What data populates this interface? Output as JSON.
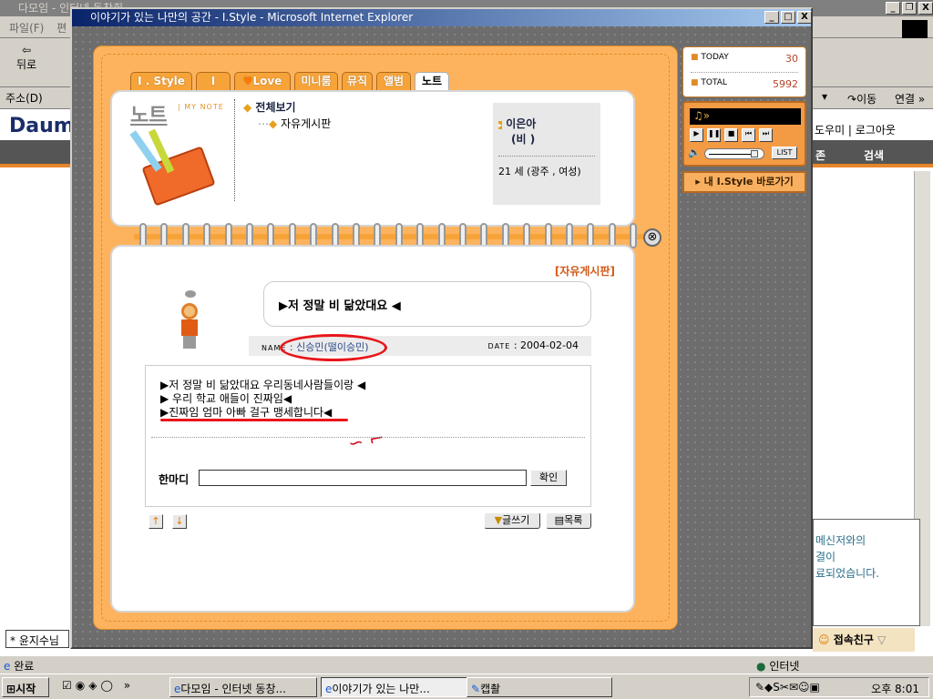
{
  "background_window": {
    "title": "다모임 - 인터넷 동창회",
    "menu_file": "파일(F)",
    "menu_edit": "편",
    "back_label": "뒤로",
    "address_label": "주소(D)",
    "go_label": "이동",
    "links_label": "연결 »",
    "logo": "Daum",
    "help_logout": "도우미 | 로그아웃",
    "nav_zone": "존",
    "nav_search": "검색",
    "messenger_lines": [
      "메신저와의",
      "결이",
      "료되었습니다."
    ],
    "friends_label": "접속친구",
    "chat_input": "* 윤지수님",
    "status_text": "완료",
    "zone_text": "인터넷"
  },
  "popup": {
    "title": "이야기가 있는 나만의 공간 - I.Style - Microsoft Internet Explorer",
    "tabs": [
      {
        "label": "I . Style"
      },
      {
        "label": "I"
      },
      {
        "label": "Love"
      },
      {
        "label": "미니룸"
      },
      {
        "label": "뮤직"
      },
      {
        "label": "앨범"
      },
      {
        "label": "노트",
        "active": true
      }
    ],
    "note_title": "노트",
    "note_subtitle": "| MY NOTE",
    "tree": {
      "root": "전체보기",
      "child": "자유게시판"
    },
    "profile": {
      "name": "이은아",
      "nickname": "(비 )",
      "info": "21 세 (광주 , 여성)"
    },
    "board_name": "[자유게시판]",
    "post": {
      "title": "▶저 정말 비 닮았대요 ◀",
      "name_label": "NAME",
      "author": ": 신승민(떨이승민)",
      "date_label": "DATE",
      "date": ": 2004-02-04",
      "body": [
        "▶저 정말 비 닮았대요 우리동네사람들이랑 ◀",
        "▶ 우리 학교 애들이 진짜임◀",
        "▶진짜임 엄마 아빠 걸구 맹세합니다◀"
      ]
    },
    "comment_label": "한마디",
    "comment_value": "",
    "confirm_label": "확인",
    "write_label": "글쓰기",
    "list_label": "목록",
    "counter": {
      "today_label": "TODAY",
      "today": "30",
      "total_label": "TOTAL",
      "total": "5992"
    },
    "player": {
      "display": "♫»",
      "list_label": "LIST",
      "volume": 0.9
    },
    "goto_label": "▸ 내 I.Style 바로가기",
    "accent_color": "#fdb35d"
  },
  "taskbar": {
    "start": "시작",
    "items": [
      "다모임 - 인터넷 동창...",
      "이야기가 있는 나만...",
      "캡촬"
    ],
    "clock": "오후 8:01"
  }
}
